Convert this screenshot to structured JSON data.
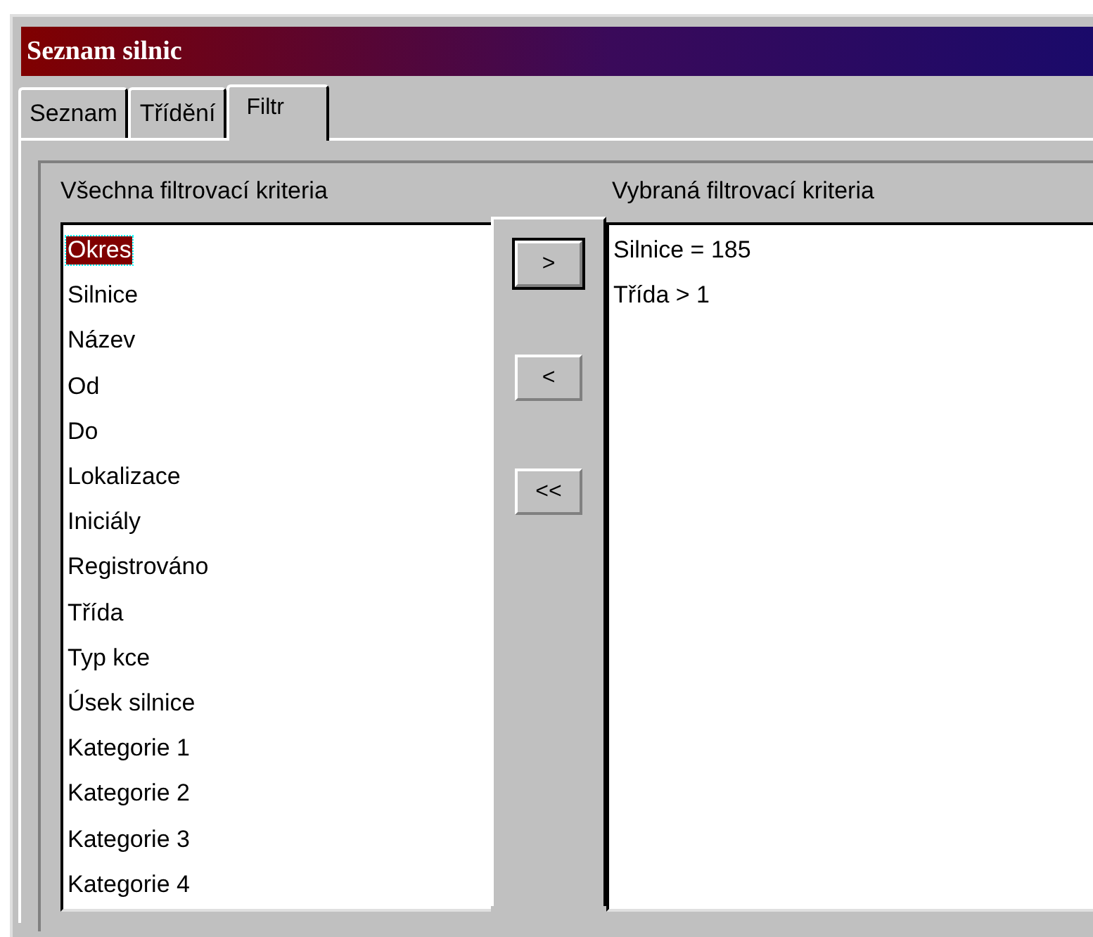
{
  "window": {
    "title": "Seznam silnic"
  },
  "tabs": [
    {
      "label": "Seznam",
      "selected": false
    },
    {
      "label": "Třídění",
      "selected": false
    },
    {
      "label": "Filtr",
      "selected": true
    }
  ],
  "all_criteria": {
    "label": "Všechna filtrovací kriteria",
    "items": [
      {
        "label": "Okres",
        "selected": true
      },
      {
        "label": "Silnice",
        "selected": false
      },
      {
        "label": "Název",
        "selected": false
      },
      {
        "label": "Od",
        "selected": false
      },
      {
        "label": "Do",
        "selected": false
      },
      {
        "label": "Lokalizace",
        "selected": false
      },
      {
        "label": "Iniciály",
        "selected": false
      },
      {
        "label": "Registrováno",
        "selected": false
      },
      {
        "label": "Třída",
        "selected": false
      },
      {
        "label": "Typ kce",
        "selected": false
      },
      {
        "label": "Úsek silnice",
        "selected": false
      },
      {
        "label": "Kategorie 1",
        "selected": false
      },
      {
        "label": "Kategorie 2",
        "selected": false
      },
      {
        "label": "Kategorie 3",
        "selected": false
      },
      {
        "label": "Kategorie 4",
        "selected": false
      }
    ]
  },
  "buttons": [
    {
      "label": ">",
      "default": true
    },
    {
      "label": "<",
      "default": false
    },
    {
      "label": "<<",
      "default": false
    }
  ],
  "selected_criteria": {
    "label": "Vybraná filtrovací kriteria",
    "items": [
      {
        "label": "Silnice = 185",
        "selected": false
      },
      {
        "label": "Třída > 1",
        "selected": false
      }
    ]
  }
}
